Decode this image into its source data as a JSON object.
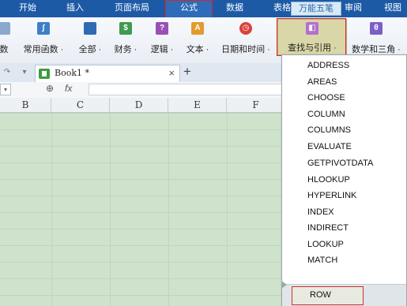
{
  "menubar": {
    "items": [
      {
        "label": "开始"
      },
      {
        "label": "插入"
      },
      {
        "label": "页面布局"
      },
      {
        "label": "公式"
      },
      {
        "label": "数据"
      },
      {
        "label": "表格"
      },
      {
        "label": "审阅"
      },
      {
        "label": "视图"
      }
    ],
    "ime_label": "万能五笔"
  },
  "ribbon": {
    "buttons": [
      {
        "label": "数",
        "icon": "insert-function-icon"
      },
      {
        "label": "常用函数 ·",
        "icon": "common-functions-icon"
      },
      {
        "label": "全部 ·",
        "icon": "all-functions-icon"
      },
      {
        "label": "财务 ·",
        "icon": "financial-icon"
      },
      {
        "label": "逻辑 ·",
        "icon": "logical-icon"
      },
      {
        "label": "文本 ·",
        "icon": "text-icon"
      },
      {
        "label": "日期和时间 ·",
        "icon": "date-time-icon"
      },
      {
        "label": "查找与引用 ·",
        "icon": "lookup-reference-icon"
      },
      {
        "label": "数学和三角 ·",
        "icon": "math-trig-icon"
      }
    ]
  },
  "tabs": {
    "document": "Book1 *",
    "close_glyph": "×",
    "new_glyph": "+"
  },
  "formula_bar": {
    "fx": "fx",
    "zoom_glyph": "⊕"
  },
  "columns": [
    "B",
    "C",
    "D",
    "E",
    "F"
  ],
  "dropdown": {
    "items": [
      "ADDRESS",
      "AREAS",
      "CHOOSE",
      "COLUMN",
      "COLUMNS",
      "EVALUATE",
      "GETPIVOTDATA",
      "HLOOKUP",
      "HYPERLINK",
      "INDEX",
      "INDIRECT",
      "LOOKUP",
      "MATCH"
    ],
    "highlighted": "ROW"
  },
  "colors": {
    "menubar": "#1d5aa6",
    "sheet": "#cfe3cc",
    "highlight_border": "#d22222",
    "lookup_button": "#d9d7a7"
  }
}
